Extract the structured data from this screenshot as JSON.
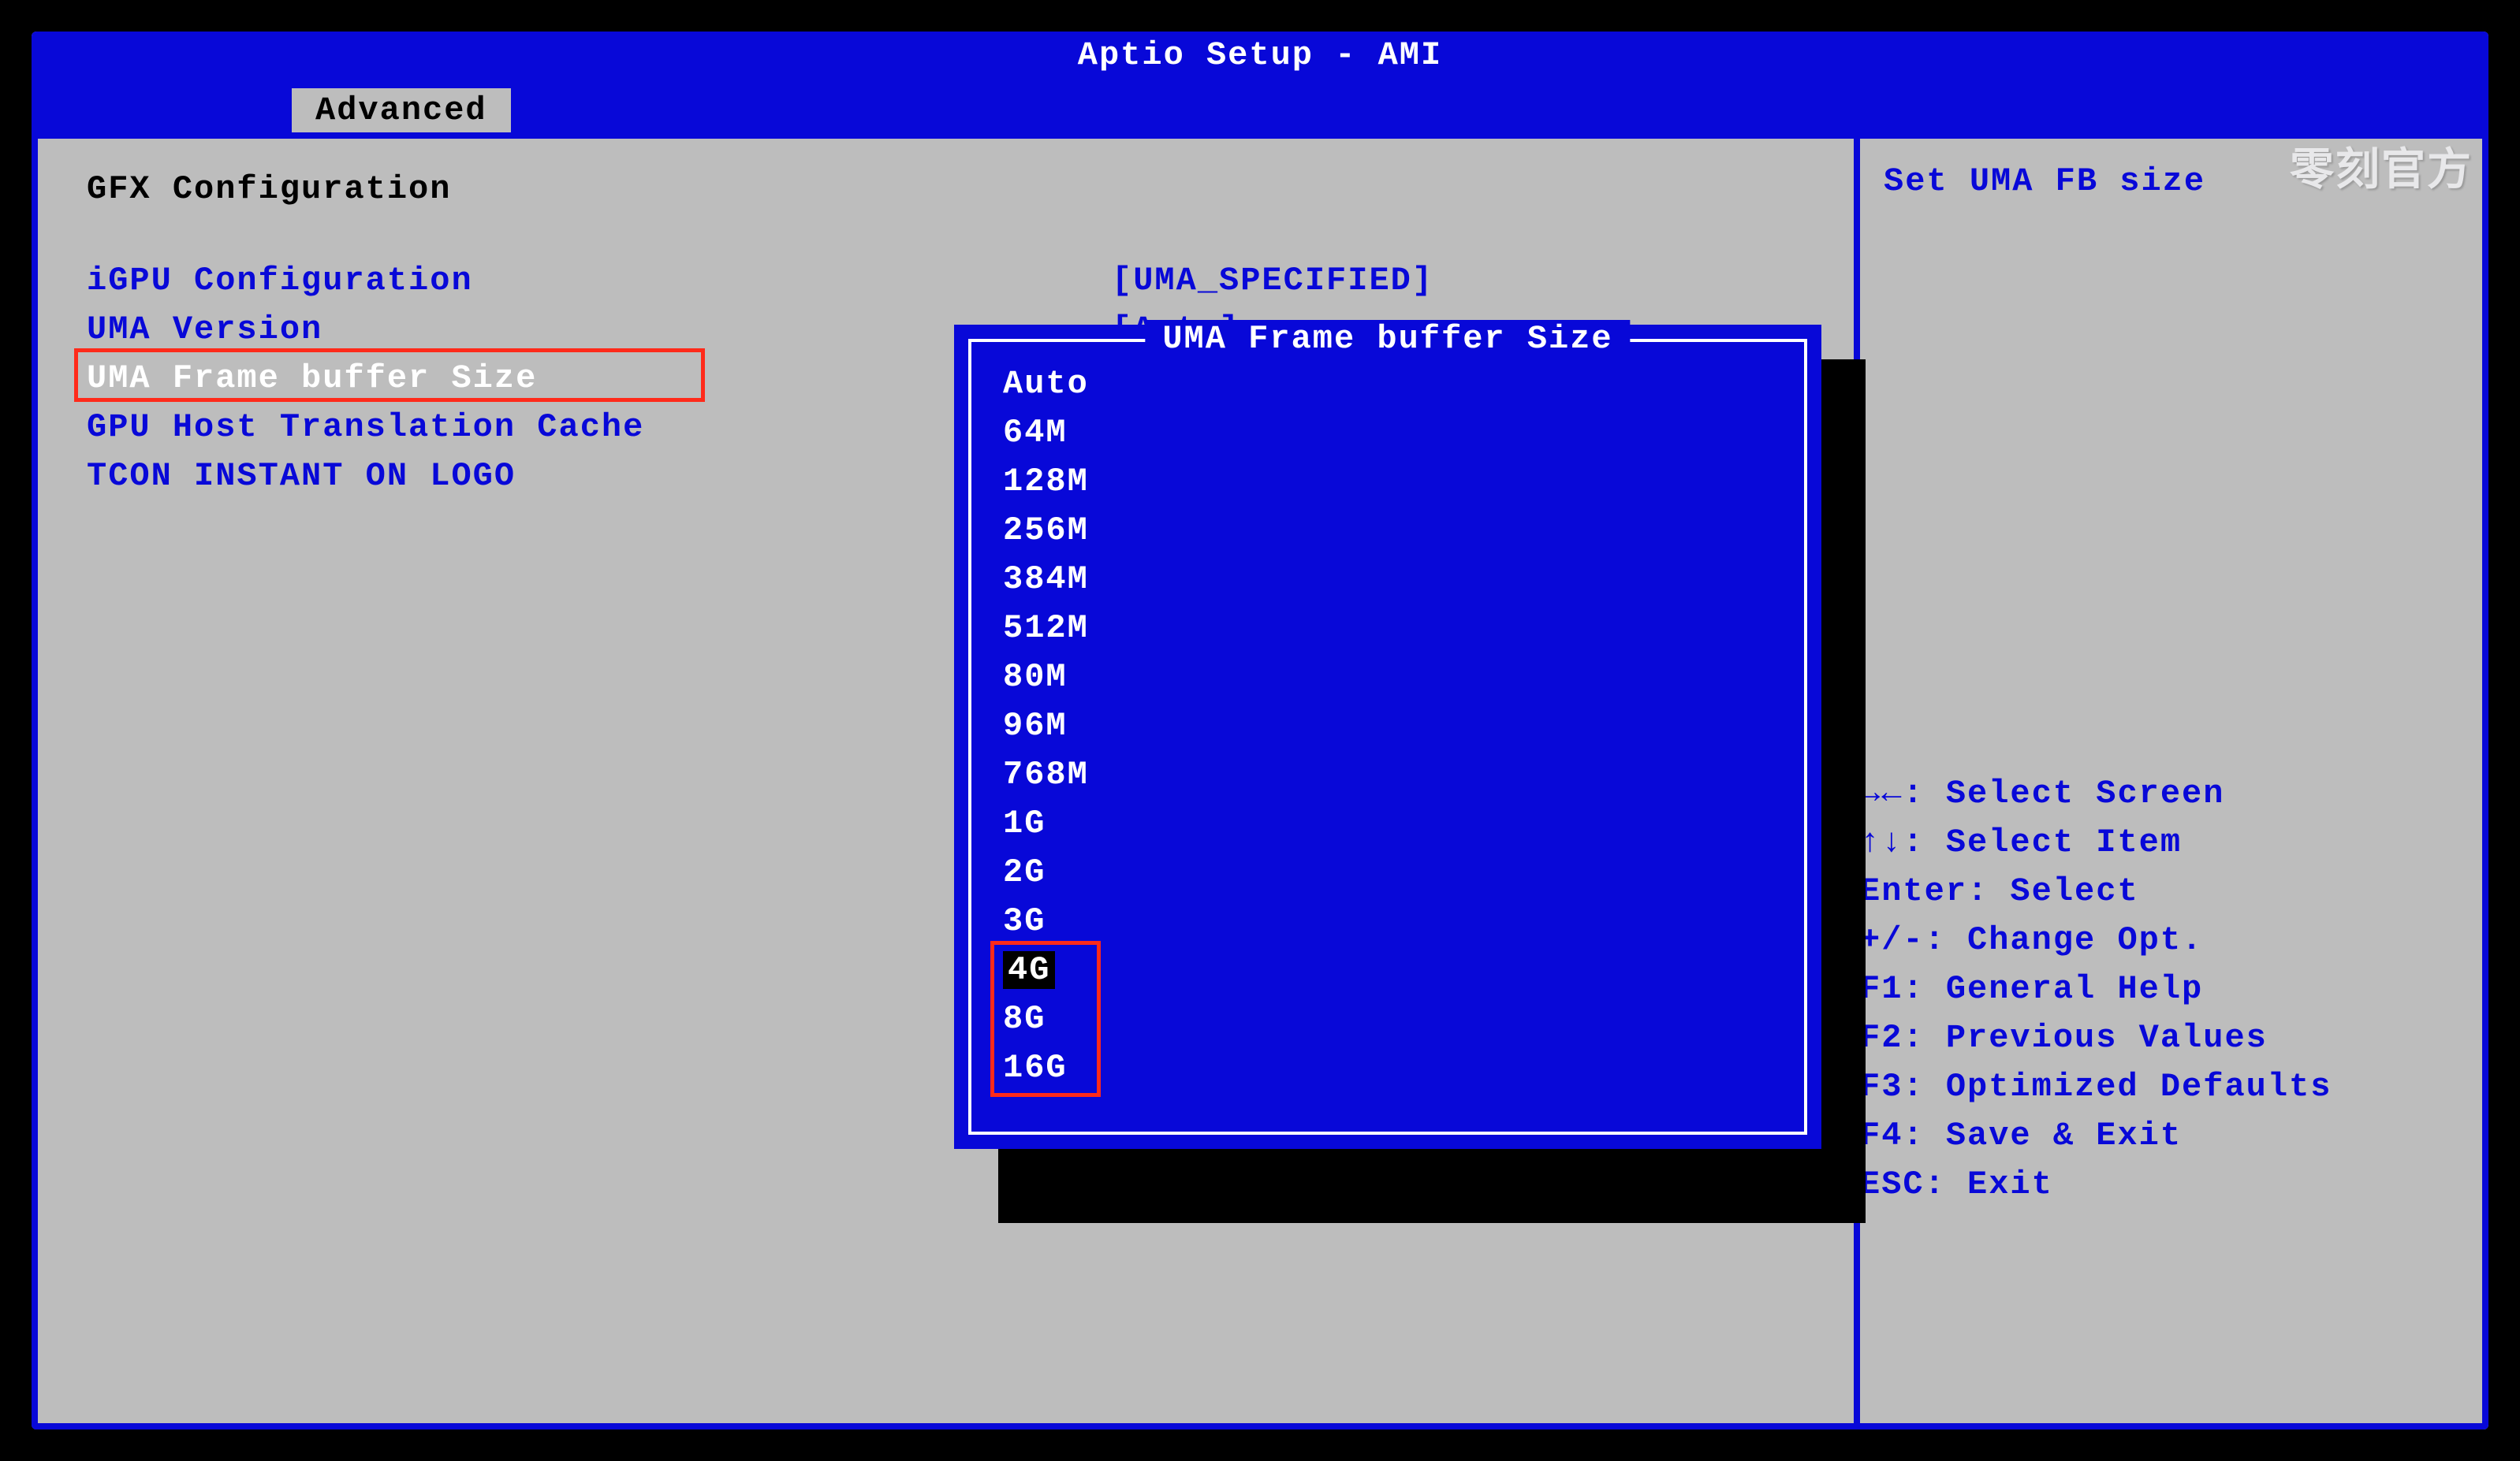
{
  "title": "Aptio Setup - AMI",
  "active_tab": "Advanced",
  "watermark": "零刻官方",
  "page_heading": "GFX Configuration",
  "settings": [
    {
      "label": "iGPU Configuration",
      "value": "[UMA_SPECIFIED]",
      "color": "blue",
      "highlighted": false
    },
    {
      "label": "UMA Version",
      "value": "[Auto]",
      "color": "blue",
      "highlighted": false
    },
    {
      "label": "UMA Frame buffer Size",
      "value": "",
      "color": "white",
      "highlighted": true
    },
    {
      "label": "GPU Host Translation Cache",
      "value": "",
      "color": "blue",
      "highlighted": false
    },
    {
      "label": "TCON INSTANT ON LOGO",
      "value": "",
      "color": "blue",
      "highlighted": false
    }
  ],
  "popup": {
    "title": "UMA Frame buffer Size",
    "options": [
      "Auto",
      "64M",
      "128M",
      "256M",
      "384M",
      "512M",
      "80M",
      "96M",
      "768M",
      "1G",
      "2G",
      "3G",
      "4G",
      "8G",
      "16G"
    ],
    "selected_index": 12,
    "red_box_start": 12,
    "red_box_end": 14
  },
  "help": {
    "description": "Set UMA FB size",
    "keys": [
      "→←: Select Screen",
      "↑↓: Select Item",
      "Enter: Select",
      "+/-: Change Opt.",
      "F1: General Help",
      "F2: Previous Values",
      "F3: Optimized Defaults",
      "F4: Save & Exit",
      "ESC: Exit"
    ]
  }
}
